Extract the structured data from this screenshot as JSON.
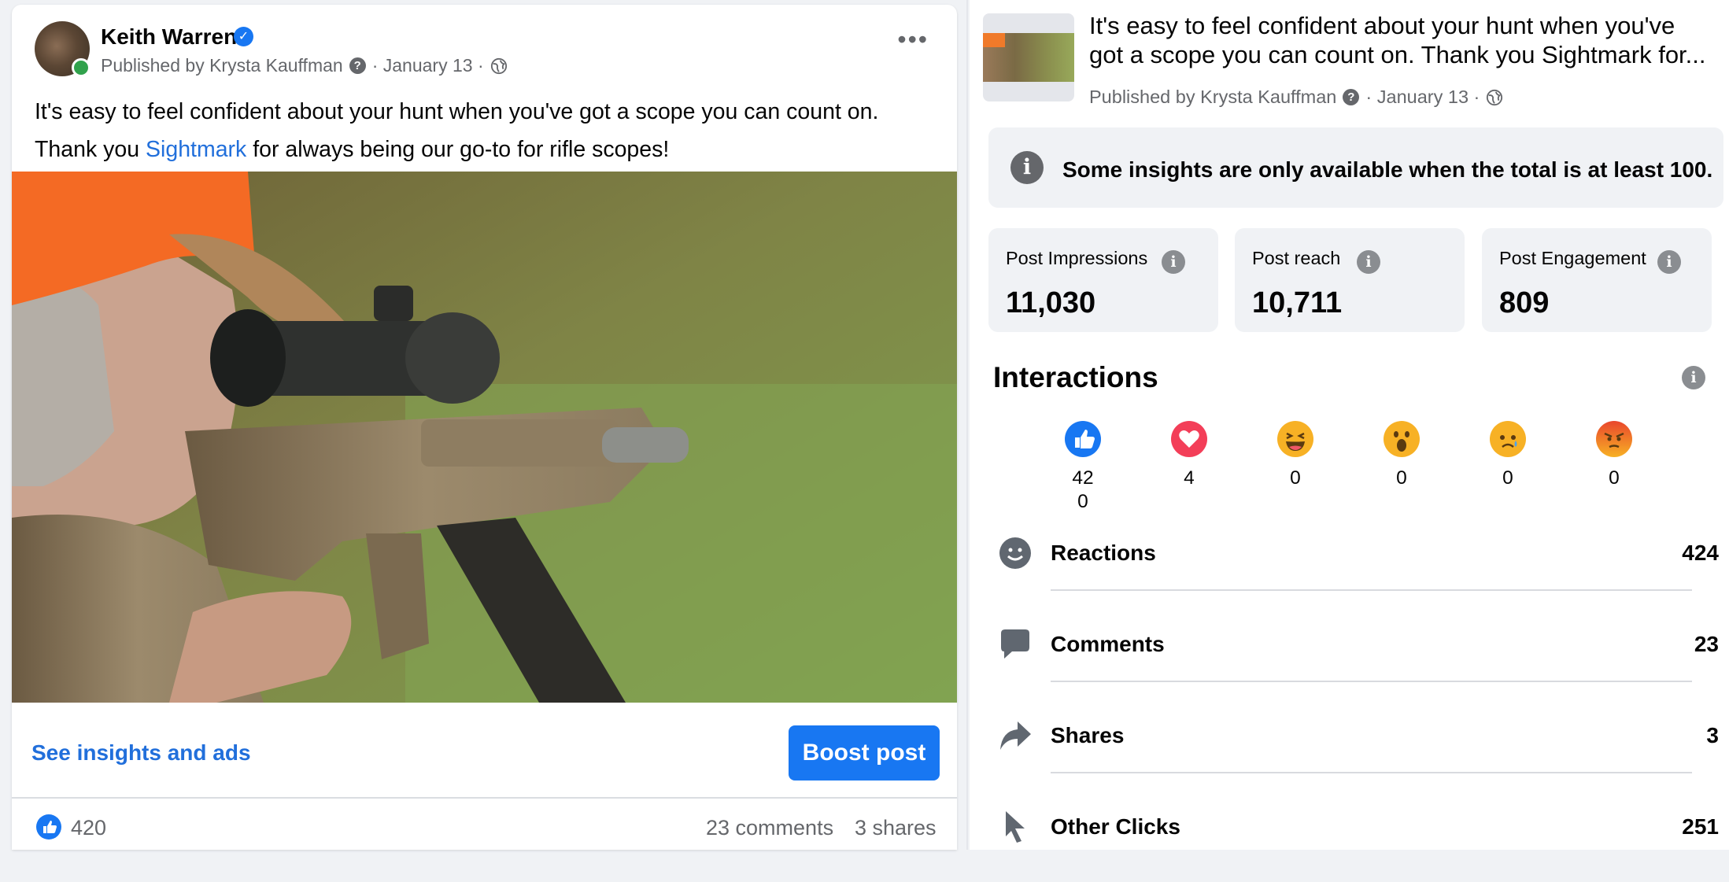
{
  "post": {
    "author": "Keith Warren",
    "published_by": "Published by Krysta Kauffman",
    "date": "· January 13 ·",
    "text_line1": "It's easy to feel confident about your hunt when you've got a scope you can count on.",
    "text_line2_prefix": "Thank you ",
    "text_line2_link": "Sightmark",
    "text_line2_suffix": " for always being our go-to for rifle scopes!",
    "see_insights": "See insights and ads",
    "boost": "Boost post",
    "likes": "420",
    "comments": "23 comments",
    "shares": "3 shares",
    "more_icon": "more-horizontal-icon"
  },
  "panel": {
    "title_line1": "It's easy to feel confident about your hunt when you've",
    "title_line2": "got a scope you can count on. Thank you Sightmark for...",
    "published_by": "Published by Krysta Kauffman",
    "date": "· January 13 ·",
    "notice": "Some insights are only available when the total is at least 100.",
    "metrics": [
      {
        "label": "Post Impressions",
        "value": "11,030"
      },
      {
        "label": "Post reach",
        "value": "10,711"
      },
      {
        "label": "Post Engagement",
        "value": "809"
      }
    ],
    "interactions_title": "Interactions",
    "reactions": [
      {
        "name": "like",
        "value": "420"
      },
      {
        "name": "love",
        "value": "4"
      },
      {
        "name": "haha",
        "value": "0"
      },
      {
        "name": "wow",
        "value": "0"
      },
      {
        "name": "sad",
        "value": "0"
      },
      {
        "name": "angry",
        "value": "0"
      }
    ],
    "rows": [
      {
        "label": "Reactions",
        "value": "424",
        "icon": "smiley-icon"
      },
      {
        "label": "Comments",
        "value": "23",
        "icon": "comment-icon"
      },
      {
        "label": "Shares",
        "value": "3",
        "icon": "share-icon"
      },
      {
        "label": "Other Clicks",
        "value": "251",
        "icon": "cursor-icon"
      }
    ]
  },
  "colors": {
    "accent": "#1877f2",
    "link": "#216fdb",
    "secondary_text": "#65676b",
    "panel_gray": "#f0f2f5"
  }
}
